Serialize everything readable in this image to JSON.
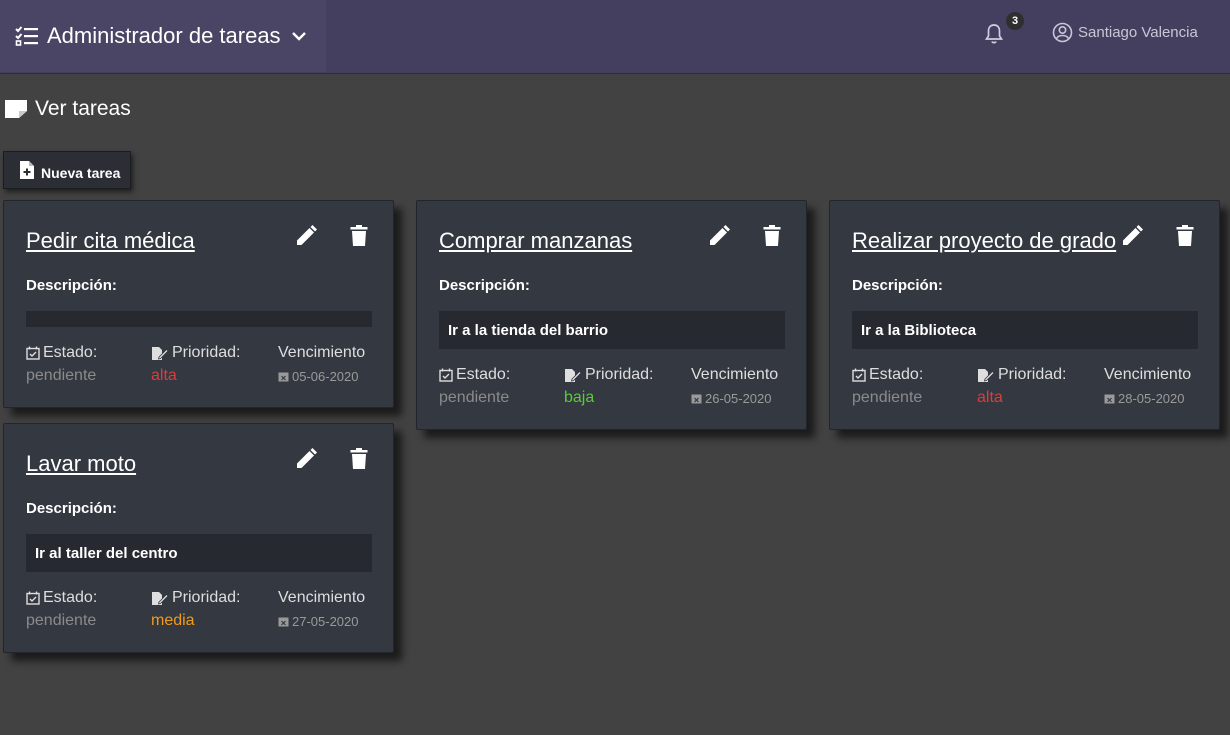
{
  "app": {
    "title": "Administrador de tareas",
    "notifications_count": "3",
    "user_name": "Santiago Valencia"
  },
  "page": {
    "section_title": "Ver tareas",
    "new_task_label": "Nueva tarea"
  },
  "labels": {
    "description": "Descripción:",
    "status": "Estado:",
    "priority": "Prioridad:",
    "due": "Vencimiento"
  },
  "colors": {
    "alta": "#e03b3b",
    "media": "#f29a1a",
    "baja": "#5cc93a"
  },
  "tasks": [
    {
      "title": "Pedir cita médica",
      "description": "",
      "status": "pendiente",
      "priority": "alta",
      "due": "05-06-2020"
    },
    {
      "title": "Comprar manzanas",
      "description": "Ir a la tienda del barrio",
      "status": "pendiente",
      "priority": "baja",
      "due": "26-05-2020"
    },
    {
      "title": "Realizar proyecto de grado",
      "description": "Ir a la Biblioteca",
      "status": "pendiente",
      "priority": "alta",
      "due": "28-05-2020"
    },
    {
      "title": "Lavar moto",
      "description": "Ir al taller del centro",
      "status": "pendiente",
      "priority": "media",
      "due": "27-05-2020"
    }
  ]
}
